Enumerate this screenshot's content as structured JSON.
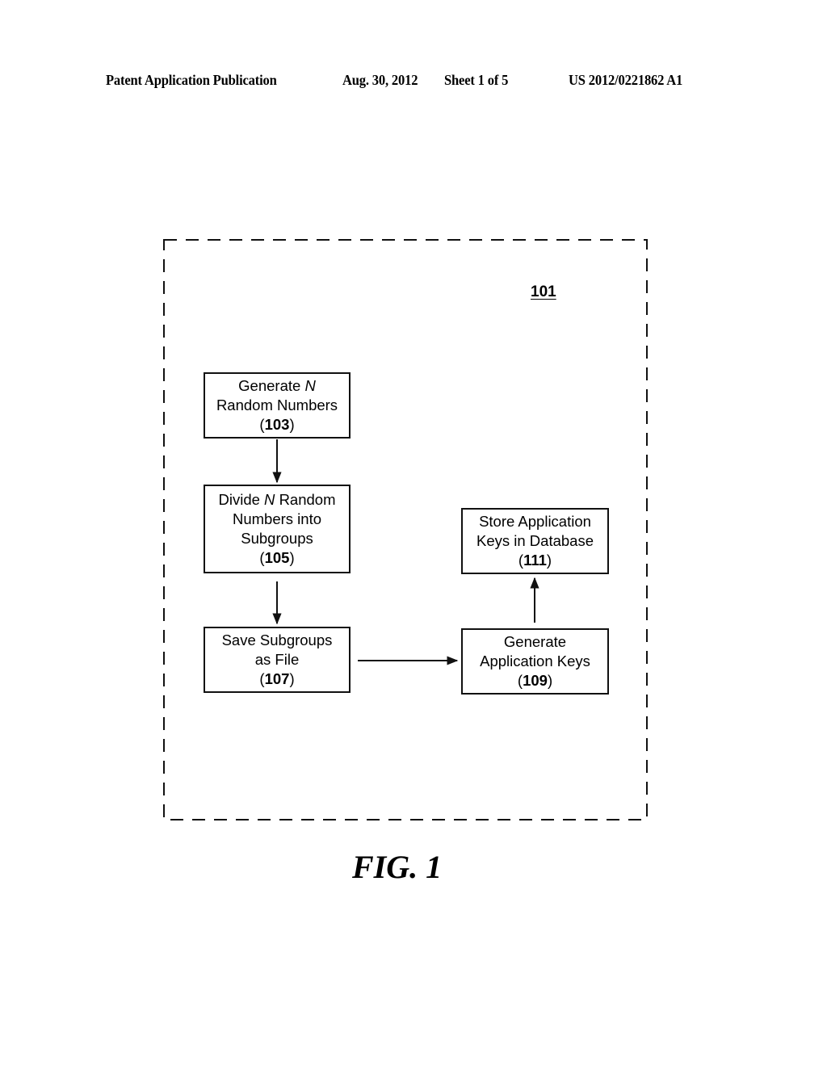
{
  "header": {
    "publication_type": "Patent Application Publication",
    "date": "Aug. 30, 2012",
    "sheet": "Sheet 1 of 5",
    "publication_number": "US 2012/0221862 A1"
  },
  "figure": {
    "container_ref": "101",
    "label": "FIG. 1",
    "boxes": [
      {
        "id": "103",
        "lines": [
          "Generate",
          "N",
          "Random Numbers"
        ],
        "ref": "103"
      },
      {
        "id": "105",
        "lines": [
          "Divide",
          "N",
          "Random",
          "Numbers into",
          "Subgroups"
        ],
        "ref": "105"
      },
      {
        "id": "107",
        "lines": [
          "Save Subgroups",
          "as File"
        ],
        "ref": "107"
      },
      {
        "id": "109",
        "lines": [
          "Generate",
          "Application Keys"
        ],
        "ref": "109"
      },
      {
        "id": "111",
        "lines": [
          "Store Application",
          "Keys in Database"
        ],
        "ref": "111"
      }
    ],
    "edges": [
      {
        "from": "103",
        "to": "105"
      },
      {
        "from": "105",
        "to": "107"
      },
      {
        "from": "107",
        "to": "109"
      },
      {
        "from": "109",
        "to": "111"
      }
    ],
    "paren_open": "(",
    "paren_close": ")"
  }
}
